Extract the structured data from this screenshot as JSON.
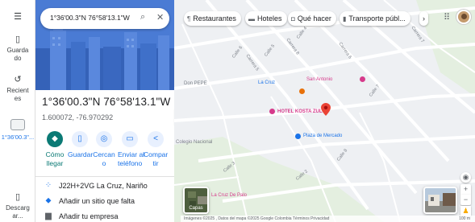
{
  "rail": {
    "saved_label": "Guardado",
    "recent_label": "Recientes",
    "recent_place": "1°36'00.3\"...",
    "download_label": "Descargar..."
  },
  "search": {
    "value": "1°36'00.3\"N 76°58'13.1\"W"
  },
  "place": {
    "title": "1°36'00.3\"N 76°58'13.1\"W",
    "coords": "1.600072, -76.970292"
  },
  "actions": [
    {
      "label_l1": "Cómo",
      "label_l2": "llegar",
      "icon": "directions-icon"
    },
    {
      "label_l1": "Guardar",
      "label_l2": "",
      "icon": "bookmark-icon"
    },
    {
      "label_l1": "Cercan",
      "label_l2": "o",
      "icon": "nearby-icon"
    },
    {
      "label_l1": "Enviar al",
      "label_l2": "teléfono",
      "icon": "phone-icon"
    },
    {
      "label_l1": "Compar",
      "label_l2": "tir",
      "icon": "share-icon"
    }
  ],
  "details": [
    {
      "text": "J22H+2VG La Cruz, Nariño",
      "icon": "plus-code-icon"
    },
    {
      "text": "Añadir un sitio que falta",
      "icon": "add-place-icon"
    },
    {
      "text": "Añadir tu empresa",
      "icon": "business-icon"
    }
  ],
  "chips": [
    {
      "label": "Restaurantes",
      "icon": "restaurant-icon"
    },
    {
      "label": "Hoteles",
      "icon": "hotel-icon"
    },
    {
      "label": "Qué hacer",
      "icon": "camera-icon"
    },
    {
      "label": "Transporte públ...",
      "icon": "transit-icon"
    }
  ],
  "map": {
    "pois": [
      {
        "label": "La Cruz",
        "color": "#1a73e8"
      },
      {
        "label": "San Antonio",
        "color": "#d63a8b"
      },
      {
        "label": "Don PEPE",
        "color": "#7a7f87"
      },
      {
        "label": "HOTEL KOSTA ZUL",
        "color": "#d63a8b"
      },
      {
        "label": "Plaza de Mercado",
        "color": "#1a73e8"
      },
      {
        "label": "La Cruz De Palo",
        "color": "#d63a8b"
      },
      {
        "label": "Colegio Nacional",
        "color": "#7a7f87"
      }
    ],
    "streets": [
      "Calle 4",
      "Calle 5",
      "Calle 6",
      "Calle 7",
      "Calle 8",
      "Carrera 5",
      "Carrera 6",
      "Carrera 7",
      "Carrera 8",
      "Calle 3",
      "Calle 2"
    ],
    "layers_label": "Capas",
    "attribution": "Imágenes ©2025 , Datos del mapa ©2025 Google   Colombia   Términos   Privacidad",
    "scale": "100 m"
  },
  "colors": {
    "accent": "#1a73e8",
    "primary_action": "#0b7a75",
    "pin": "#ea4335",
    "hero": "#3f6fc9"
  }
}
